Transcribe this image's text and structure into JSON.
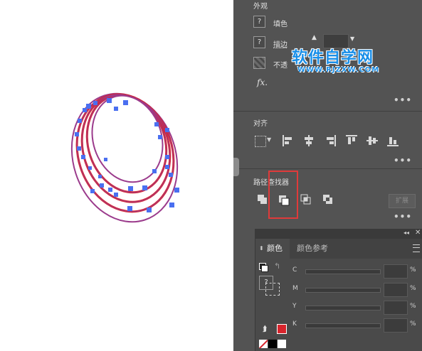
{
  "appearance": {
    "title": "外观",
    "fill_label": "填色",
    "stroke_label": "描边",
    "opacity_label": "不透",
    "fx_label": "fx."
  },
  "align": {
    "title": "对齐"
  },
  "pathfinder": {
    "title": "路径查找器",
    "expand_label": "扩展"
  },
  "color": {
    "tab_color": "颜色",
    "tab_guide": "颜色参考",
    "channels": [
      "C",
      "M",
      "Y",
      "K"
    ],
    "percent": "%"
  },
  "watermark": {
    "line1": "软件自学网",
    "line2": "WWW.RJZXW.COM"
  },
  "more_glyph": "•••",
  "question_glyph": "?",
  "colors": {
    "panel_bg": "#535353",
    "path_stroke": "#9b3b8c",
    "path_fill": "#d8242c",
    "anchor": "#4a6ff0",
    "highlight": "#e03a3a",
    "watermark": "#1a8fe8"
  },
  "icons": [
    "question-icon",
    "fx-icon",
    "align-icon",
    "shape-mode-icon",
    "color-swatch-icon"
  ]
}
